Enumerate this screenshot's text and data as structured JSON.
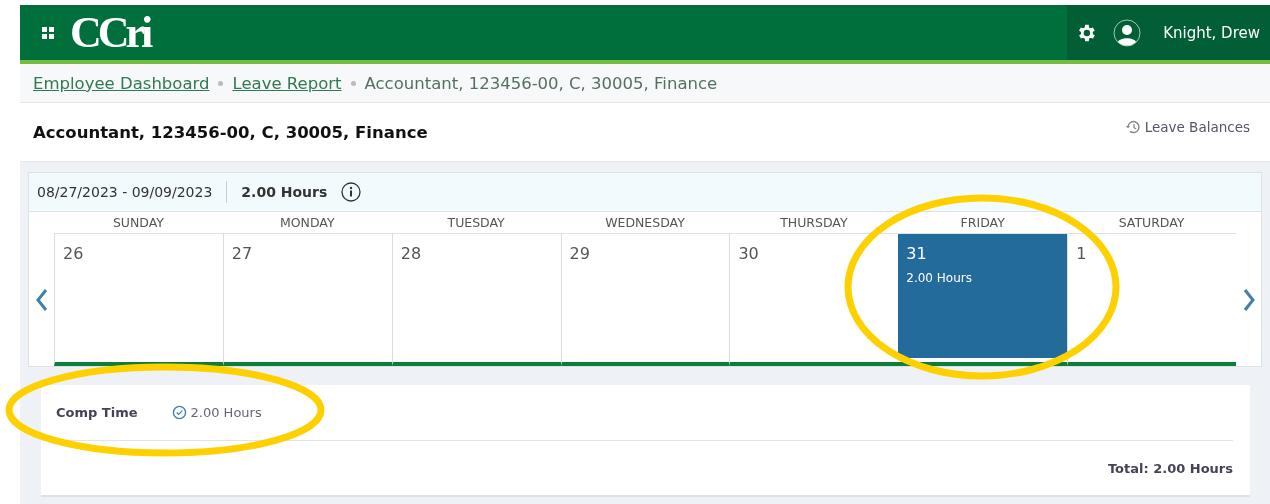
{
  "header": {
    "logo": "CCri",
    "user": "Knight, Drew"
  },
  "breadcrumbs": [
    {
      "label": "Employee Dashboard",
      "kind": "link"
    },
    {
      "label": "Leave Report",
      "kind": "link"
    },
    {
      "label": "Accountant, 123456-00, C, 30005, Finance",
      "kind": "current"
    }
  ],
  "page_title": "Accountant, 123456-00, C, 30005, Finance",
  "leave_balances": "Leave Balances",
  "period": {
    "dates": "08/27/2023 - 09/09/2023",
    "hours": "2.00 Hours"
  },
  "weekdays": [
    "SUNDAY",
    "MONDAY",
    "TUESDAY",
    "WEDNESDAY",
    "THURSDAY",
    "FRIDAY",
    "SATURDAY"
  ],
  "days": [
    {
      "date": "26",
      "selected": false
    },
    {
      "date": "27",
      "selected": false
    },
    {
      "date": "28",
      "selected": false
    },
    {
      "date": "29",
      "selected": false
    },
    {
      "date": "30",
      "selected": false
    },
    {
      "date": "31",
      "selected": true,
      "hours": "2.00 Hours"
    },
    {
      "date": "1",
      "selected": false
    }
  ],
  "summary": {
    "rows": [
      {
        "label": "Comp Time",
        "hours": "2.00 Hours"
      }
    ],
    "total": "Total: 2.00 Hours"
  }
}
